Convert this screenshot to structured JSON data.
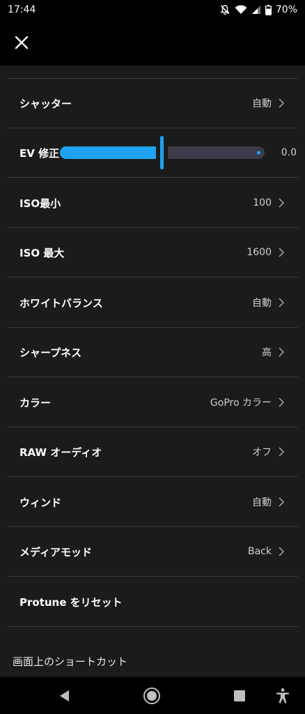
{
  "status_bar": {
    "time": "17:44",
    "battery": "70%"
  },
  "settings": [
    {
      "label": "シャッター",
      "value": "自動",
      "chevron": true
    },
    {
      "label": "EV 修正",
      "value": "0.0",
      "slider": 0.5
    },
    {
      "label": "ISO最小",
      "value": "100",
      "chevron": true
    },
    {
      "label": "ISO 最大",
      "value": "1600",
      "chevron": true
    },
    {
      "label": "ホワイトバランス",
      "value": "自動",
      "chevron": true
    },
    {
      "label": "シャープネス",
      "value": "高",
      "chevron": true
    },
    {
      "label": "カラー",
      "value": "GoPro カラー",
      "chevron": true
    },
    {
      "label": "RAW オーディオ",
      "value": "オフ",
      "chevron": true
    },
    {
      "label": "ウィンド",
      "value": "自動",
      "chevron": true
    },
    {
      "label": "メディアモッド",
      "value": "Back",
      "chevron": true
    },
    {
      "label": "Protune をリセット"
    }
  ],
  "section_label": "画面上のショートカット",
  "colors": {
    "accent": "#1fa2f2",
    "background": "#1b1b1b",
    "divider": "#3a3a3a"
  },
  "icons": {
    "close": "close-icon",
    "back": "nav-back-icon",
    "home": "nav-home-icon",
    "recents": "nav-recents-icon",
    "accessibility": "accessibility-icon"
  }
}
